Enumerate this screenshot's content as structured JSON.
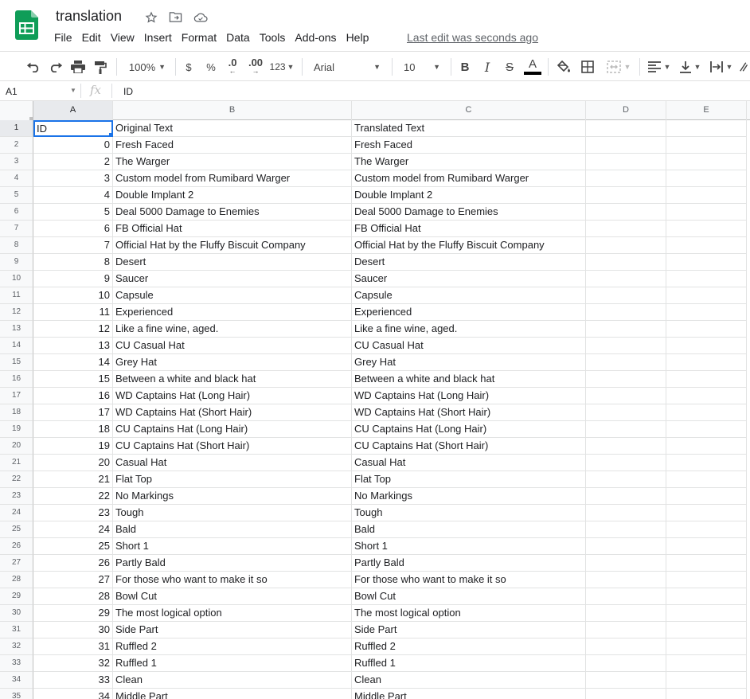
{
  "app": {
    "title": "translation",
    "last_edit": "Last edit was seconds ago",
    "menu": [
      "File",
      "Edit",
      "View",
      "Insert",
      "Format",
      "Data",
      "Tools",
      "Add-ons",
      "Help"
    ]
  },
  "toolbar": {
    "zoom": "100%",
    "currency": "$",
    "percent": "%",
    "decrease_decimals": ".0",
    "increase_decimals": ".00",
    "more_formats": "123",
    "font": "Arial",
    "font_size": "10",
    "bold": "B",
    "italic": "I",
    "strike": "S",
    "text_color": "A",
    "text_color_value": "#000000"
  },
  "formula_bar": {
    "name_box": "A1",
    "fx": "fx",
    "value": "ID"
  },
  "sheet": {
    "columns": [
      "A",
      "B",
      "C",
      "D",
      "E"
    ],
    "selected_cell": "A1",
    "rows": [
      [
        "1",
        "ID",
        "Original Text",
        "Translated Text"
      ],
      [
        "2",
        "0",
        "Fresh Faced",
        "Fresh Faced"
      ],
      [
        "3",
        "2",
        "The Warger",
        "The Warger"
      ],
      [
        "4",
        "3",
        "Custom model from Rumibard Warger",
        "Custom model from Rumibard Warger"
      ],
      [
        "5",
        "4",
        "Double Implant 2",
        "Double Implant 2"
      ],
      [
        "6",
        "5",
        "Deal 5000 Damage to Enemies",
        "Deal 5000 Damage to Enemies"
      ],
      [
        "7",
        "6",
        "FB Official Hat",
        "FB Official Hat"
      ],
      [
        "8",
        "7",
        "Official Hat by the Fluffy Biscuit Company",
        "Official Hat by the Fluffy Biscuit Company"
      ],
      [
        "9",
        "8",
        "Desert",
        "Desert"
      ],
      [
        "10",
        "9",
        "Saucer",
        "Saucer"
      ],
      [
        "11",
        "10",
        "Capsule",
        "Capsule"
      ],
      [
        "12",
        "11",
        "Experienced",
        "Experienced"
      ],
      [
        "13",
        "12",
        "Like a fine wine, aged.",
        "Like a fine wine, aged."
      ],
      [
        "14",
        "13",
        "CU Casual Hat",
        "CU Casual Hat"
      ],
      [
        "15",
        "14",
        "Grey Hat",
        "Grey Hat"
      ],
      [
        "16",
        "15",
        "Between a white and black hat",
        "Between a white and black hat"
      ],
      [
        "17",
        "16",
        "WD Captains Hat (Long Hair)",
        "WD Captains Hat (Long Hair)"
      ],
      [
        "18",
        "17",
        "WD Captains Hat (Short Hair)",
        "WD Captains Hat (Short Hair)"
      ],
      [
        "19",
        "18",
        "CU Captains Hat (Long Hair)",
        "CU Captains Hat (Long Hair)"
      ],
      [
        "20",
        "19",
        "CU Captains Hat (Short Hair)",
        "CU Captains Hat (Short Hair)"
      ],
      [
        "21",
        "20",
        "Casual Hat",
        "Casual Hat"
      ],
      [
        "22",
        "21",
        "Flat Top",
        "Flat Top"
      ],
      [
        "23",
        "22",
        "No Markings",
        "No Markings"
      ],
      [
        "24",
        "23",
        "Tough",
        "Tough"
      ],
      [
        "25",
        "24",
        "Bald",
        "Bald"
      ],
      [
        "26",
        "25",
        "Short 1",
        "Short 1"
      ],
      [
        "27",
        "26",
        "Partly Bald",
        "Partly Bald"
      ],
      [
        "28",
        "27",
        "For those who want to make it so",
        "For those who want to make it so"
      ],
      [
        "29",
        "28",
        "Bowl Cut",
        "Bowl Cut"
      ],
      [
        "30",
        "29",
        "The most logical option",
        "The most logical option"
      ],
      [
        "31",
        "30",
        "Side Part",
        "Side Part"
      ],
      [
        "32",
        "31",
        "Ruffled 2",
        "Ruffled 2"
      ],
      [
        "33",
        "32",
        "Ruffled 1",
        "Ruffled 1"
      ],
      [
        "34",
        "33",
        "Clean",
        "Clean"
      ],
      [
        "35",
        "34",
        "Middle Part",
        "Middle Part"
      ]
    ]
  }
}
